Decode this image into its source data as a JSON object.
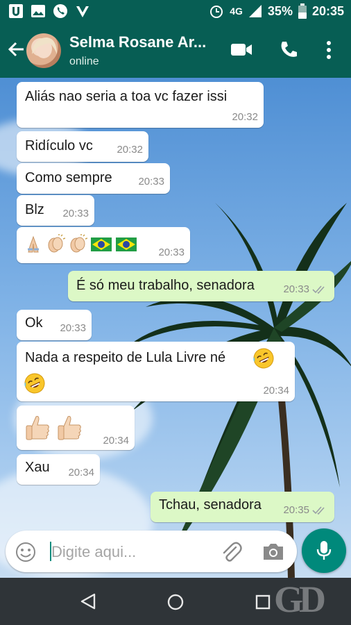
{
  "status_bar": {
    "network": "4G",
    "battery": "35%",
    "time": "20:35"
  },
  "header": {
    "contact_name": "Selma Rosane Ar...",
    "contact_status": "online"
  },
  "messages": [
    {
      "text": "Aliás  nao seria a toa vc fazer issi",
      "time": "20:32"
    },
    {
      "text": "Ridículo vc",
      "time": "20:32"
    },
    {
      "text": "Como sempre",
      "time": "20:33"
    },
    {
      "text": "Blz",
      "time": "20:33"
    },
    {
      "emojis": [
        "folded-hands",
        "clapping-hands",
        "clapping-hands",
        "brazil-flag",
        "brazil-flag"
      ],
      "time": "20:33"
    },
    {
      "text": "É só meu trabalho, senadora",
      "time": "20:33"
    },
    {
      "text": "Ok",
      "time": "20:33"
    },
    {
      "text": "Nada a respeito  de Lula Livre né",
      "time": "20:34",
      "emojis": [
        "rolling-laughing",
        "rolling-laughing"
      ]
    },
    {
      "emojis": [
        "thumbs-up",
        "thumbs-up"
      ],
      "time": "20:34"
    },
    {
      "text": "Xau",
      "time": "20:34"
    },
    {
      "text": "Tchau, senadora",
      "time": "20:35"
    }
  ],
  "input": {
    "placeholder": "Digite aqui..."
  },
  "watermark": "GD",
  "colors": {
    "header": "#075e54",
    "incoming_bubble": "#ffffff",
    "outgoing_bubble": "#dcf8c6",
    "accent": "#00897b",
    "read_ticks": "#9aa0a6"
  }
}
